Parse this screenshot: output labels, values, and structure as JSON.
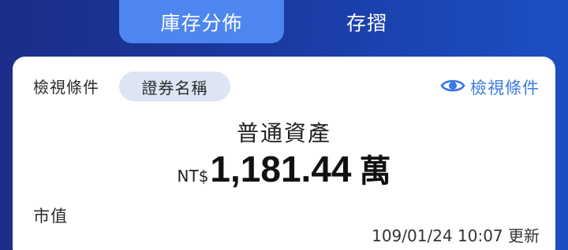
{
  "tabs": [
    {
      "label": "庫存分佈",
      "active": true
    },
    {
      "label": "存摺",
      "active": false
    }
  ],
  "filter": {
    "label": "檢視條件",
    "chip": "證券名稱"
  },
  "view_button": {
    "label": "檢視條件",
    "icon": "eye-icon"
  },
  "asset": {
    "title": "普通資產",
    "currency": "NT$",
    "amount": "1,181.44",
    "unit": "萬"
  },
  "market_label": "市值",
  "updated_text": "109/01/24 10:07 更新",
  "colors": {
    "accent": "#3a78e6",
    "active_tab": "#4d86ef",
    "chip_bg": "#dde5f4"
  }
}
